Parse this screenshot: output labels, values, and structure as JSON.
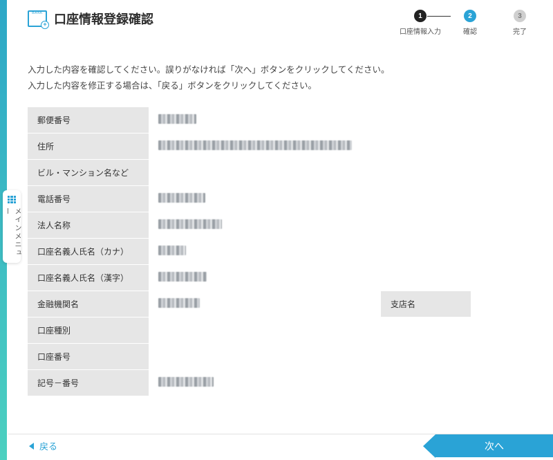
{
  "header": {
    "title": "口座情報登録確認",
    "steps": [
      {
        "num": "1",
        "label": "口座情報入力"
      },
      {
        "num": "2",
        "label": "確認"
      },
      {
        "num": "3",
        "label": "完了"
      }
    ]
  },
  "sidebar_tab": {
    "label": "メインメニュー"
  },
  "instructions": {
    "line1": "入力した内容を確認してください。誤りがなければ「次へ」ボタンをクリックしてください。",
    "line2": "入力した内容を修正する場合は、「戻る」ボタンをクリックしてください。"
  },
  "rows": {
    "postal_label": "郵便番号",
    "address_label": "住所",
    "building_label": "ビル・マンション名など",
    "phone_label": "電話番号",
    "corp_label": "法人名称",
    "kana_label": "口座名義人氏名（カナ）",
    "kanji_label": "口座名義人氏名（漢字）",
    "bank_label": "金融機関名",
    "branch_label": "支店名",
    "type_label": "口座種別",
    "num_label": "口座番号",
    "symnum_label": "記号－番号"
  },
  "nav": {
    "back": "戻る",
    "next": "次へ"
  }
}
